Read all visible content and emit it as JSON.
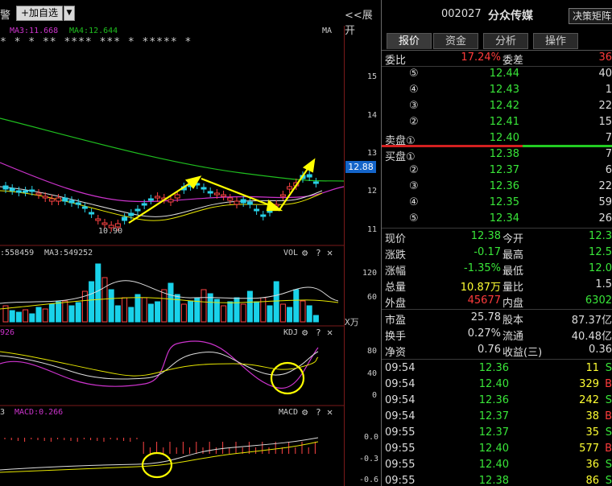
{
  "toolbar": {
    "alert": "警",
    "add_fav": "+加自选",
    "expand": "<<展开"
  },
  "kline": {
    "ma3": "MA3:11.668",
    "ma4": "MA4:12.644",
    "ma_tag": "MA",
    "low_label": "10.90",
    "price_tag": "12.88",
    "price_ticks": [
      "15",
      "14",
      "13",
      "12",
      "11"
    ]
  },
  "vol": {
    "label_left": ":558459",
    "ma3": "MA3:549252",
    "name": "VOL",
    "ticks": [
      "120",
      "60"
    ],
    "unit": "X万"
  },
  "kdj": {
    "label_left": "926",
    "name": "KDJ",
    "ticks": [
      "80",
      "40",
      "0"
    ]
  },
  "macd": {
    "label_left": "3",
    "macd": "MACD:0.266",
    "name": "MACD",
    "ticks": [
      "0.0",
      "-0.3",
      "-0.6"
    ]
  },
  "stock": {
    "code": "002027",
    "name": "分众传媒",
    "btn": "决策矩阵"
  },
  "tabs": [
    "报价",
    "资金",
    "分析",
    "操作"
  ],
  "commission": {
    "ratio_label": "委比",
    "ratio": "17.24%",
    "diff_label": "委差",
    "diff": "36"
  },
  "asks": [
    {
      "lv": "⑤",
      "price": "12.44",
      "vol": "40"
    },
    {
      "lv": "④",
      "price": "12.43",
      "vol": "1"
    },
    {
      "lv": "③",
      "price": "12.42",
      "vol": "22"
    },
    {
      "lv": "②",
      "price": "12.41",
      "vol": "15"
    },
    {
      "lv": "卖盘①",
      "price": "12.40",
      "vol": "7"
    }
  ],
  "bids": [
    {
      "lv": "买盘①",
      "price": "12.38",
      "vol": "7"
    },
    {
      "lv": "②",
      "price": "12.37",
      "vol": "6"
    },
    {
      "lv": "③",
      "price": "12.36",
      "vol": "22"
    },
    {
      "lv": "④",
      "price": "12.35",
      "vol": "59"
    },
    {
      "lv": "⑤",
      "price": "12.34",
      "vol": "26"
    }
  ],
  "stats": [
    {
      "l1": "现价",
      "v1": "12.38",
      "c1": "green",
      "l2": "今开",
      "v2": "12.3",
      "c2": "green"
    },
    {
      "l1": "涨跌",
      "v1": "-0.17",
      "c1": "green",
      "l2": "最高",
      "v2": "12.5",
      "c2": "green"
    },
    {
      "l1": "涨幅",
      "v1": "-1.35%",
      "c1": "green",
      "l2": "最低",
      "v2": "12.0",
      "c2": "green"
    },
    {
      "l1": "总量",
      "v1": "10.87万",
      "c1": "yellow",
      "l2": "量比",
      "v2": "1.5",
      "c2": "white"
    },
    {
      "l1": "外盘",
      "v1": "45677",
      "c1": "red",
      "l2": "内盘",
      "v2": "6302",
      "c2": "green"
    }
  ],
  "stats2": [
    {
      "l1": "市盈",
      "v1": "25.78",
      "l2": "股本",
      "v2": "87.37亿"
    },
    {
      "l1": "换手",
      "v1": "0.27%",
      "l2": "流通",
      "v2": "40.48亿"
    },
    {
      "l1": "净资",
      "v1": "0.76",
      "l2": "收益(三)",
      "v2": "0.36"
    }
  ],
  "ticks": [
    {
      "t": "09:54",
      "p": "12.36",
      "v": "11",
      "s": "S",
      "c": "green"
    },
    {
      "t": "09:54",
      "p": "12.40",
      "v": "329",
      "s": "B",
      "c": "red"
    },
    {
      "t": "09:54",
      "p": "12.36",
      "v": "242",
      "s": "S",
      "c": "green"
    },
    {
      "t": "09:54",
      "p": "12.37",
      "v": "38",
      "s": "B",
      "c": "red"
    },
    {
      "t": "09:55",
      "p": "12.37",
      "v": "35",
      "s": "S",
      "c": "green"
    },
    {
      "t": "09:55",
      "p": "12.40",
      "v": "577",
      "s": "B",
      "c": "red"
    },
    {
      "t": "09:55",
      "p": "12.40",
      "v": "36",
      "s": "S",
      "c": "green"
    },
    {
      "t": "09:55",
      "p": "12.38",
      "v": "86",
      "s": "S",
      "c": "green"
    }
  ]
}
